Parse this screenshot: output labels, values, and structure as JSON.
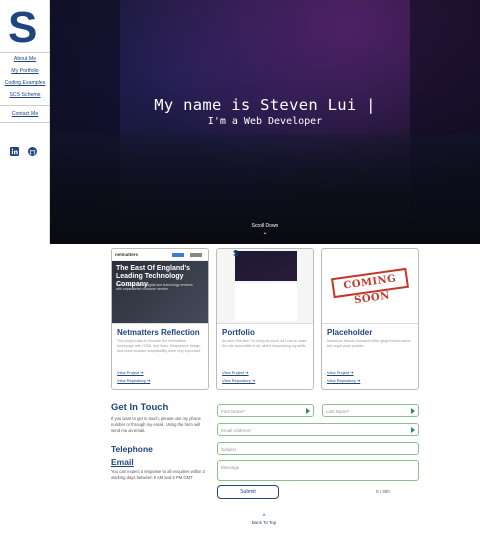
{
  "sidebar": {
    "logo": "S",
    "nav": [
      {
        "label": "About Me"
      },
      {
        "label": "My Portfolio"
      },
      {
        "label": "Coding Examples"
      },
      {
        "label": "SCS Scheme"
      }
    ],
    "contact": "Contact Me",
    "social_icons": [
      "linkedin-icon",
      "github-icon"
    ]
  },
  "hero": {
    "title": "My name is Steven Lui",
    "cursor": "|",
    "subtitle": "I'm a Web Developer",
    "scroll_label": "Scroll Down",
    "scroll_glyph": "⌄"
  },
  "cards": [
    {
      "title": "Netmatters Reflection",
      "description": "This project was to recreate the Netmatters homepage with HTML and Sass. Responsive design and cross browser compatibility were very important.",
      "link1": "View Project ➔",
      "link2": "View Repository ➔",
      "thumb": {
        "logo": "netmatters",
        "headline": "The East Of England's Leading Technology Company",
        "subtext": "Performance driven digital and technology services with unparalleled customer service."
      }
    },
    {
      "title": "Portfolio",
      "description": "As seen this site! I'm doing as much as I can to make the site accessible to all, whilst showcasing my skills.",
      "link1": "View Project ➔",
      "link2": "View Repository ➔",
      "thumb": {
        "letter": "S"
      }
    },
    {
      "title": "Placeholder",
      "description": "Macaroon biscuit croissant toffee gingerbread icebox tart sugar plum powder.",
      "link1": "View Project ➔",
      "link2": "View Repository ➔",
      "thumb": {
        "stamp": "COMING SOON"
      }
    }
  ],
  "contact": {
    "heading": "Get In Touch",
    "intro": "If you want to get in touch, please use my phone number or through my email. Using the form will send me an email.",
    "telephone": "Telephone",
    "email": "Email",
    "response": "You can expect a response to all enquiries within 3 working days between 9 AM and 5 PM GMT",
    "form": {
      "first_name": "First Name*",
      "last_name": "Last Name*",
      "email": "Email Address*",
      "subject": "Subject",
      "message": "Message",
      "submit": "Submit",
      "counter": "0 / 300"
    }
  },
  "footer": {
    "back_to_top": "Back To Top",
    "glyph": "^"
  },
  "colors": {
    "brand": "#1e4580",
    "field_border": "#8fbf8f",
    "stamp": "#c0392b"
  }
}
